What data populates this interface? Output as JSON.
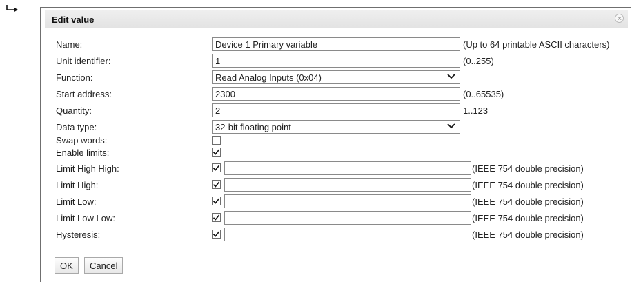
{
  "dialog": {
    "title": "Edit value"
  },
  "fields": {
    "name": {
      "label": "Name:",
      "value": "Device 1 Primary variable",
      "hint": "(Up to 64 printable ASCII characters)"
    },
    "unit_identifier": {
      "label": "Unit identifier:",
      "value": "1",
      "hint": "(0..255)"
    },
    "function": {
      "label": "Function:",
      "selected": "Read Analog Inputs (0x04)"
    },
    "start_address": {
      "label": "Start address:",
      "value": "2300",
      "hint": "(0..65535)"
    },
    "quantity": {
      "label": "Quantity:",
      "value": "2",
      "hint": "1..123"
    },
    "data_type": {
      "label": "Data type:",
      "selected": "32-bit floating point"
    },
    "swap_words": {
      "label": "Swap words:",
      "checked": false
    },
    "enable_limits": {
      "label": "Enable limits:",
      "checked": true
    },
    "limit_high_high": {
      "label": "Limit High High:",
      "checked": true,
      "value": "",
      "hint": "(IEEE 754 double precision)"
    },
    "limit_high": {
      "label": "Limit High:",
      "checked": true,
      "value": "",
      "hint": "(IEEE 754 double precision)"
    },
    "limit_low": {
      "label": "Limit Low:",
      "checked": true,
      "value": "",
      "hint": "(IEEE 754 double precision)"
    },
    "limit_low_low": {
      "label": "Limit Low Low:",
      "checked": true,
      "value": "",
      "hint": "(IEEE 754 double precision)"
    },
    "hysteresis": {
      "label": "Hysteresis:",
      "checked": true,
      "value": "",
      "hint": "(IEEE 754 double precision)"
    }
  },
  "buttons": {
    "ok": "OK",
    "cancel": "Cancel"
  },
  "icons": {
    "pointer": "return-arrow-icon",
    "close": "close-icon",
    "dropdown": "chevron-down-icon",
    "check": "checkmark-icon"
  }
}
